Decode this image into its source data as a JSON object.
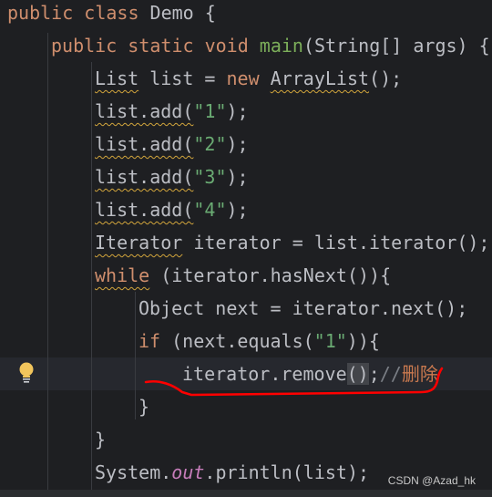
{
  "code_lines": [
    {
      "indent": 0,
      "tokens": [
        [
          "kw",
          "public class "
        ],
        [
          "",
          "Demo {"
        ]
      ]
    },
    {
      "indent": 4,
      "tokens": [
        [
          "kw",
          "public static void "
        ],
        [
          "fnd",
          "main"
        ],
        [
          "",
          "(String[] args) {"
        ]
      ]
    },
    {
      "indent": 8,
      "tokens": [
        [
          "warn",
          "List"
        ],
        [
          "",
          " list = "
        ],
        [
          "kw",
          "new "
        ],
        [
          "warn",
          "ArrayList"
        ],
        [
          "",
          "();"
        ]
      ]
    },
    {
      "indent": 8,
      "tokens": [
        [
          "warn",
          "list.add("
        ],
        [
          "str",
          "\"1\""
        ],
        [
          "",
          ");"
        ]
      ]
    },
    {
      "indent": 8,
      "tokens": [
        [
          "warn",
          "list.add("
        ],
        [
          "str",
          "\"2\""
        ],
        [
          "",
          ");"
        ]
      ]
    },
    {
      "indent": 8,
      "tokens": [
        [
          "warn",
          "list.add("
        ],
        [
          "str",
          "\"3\""
        ],
        [
          "",
          ");"
        ]
      ]
    },
    {
      "indent": 8,
      "tokens": [
        [
          "warn",
          "list.add("
        ],
        [
          "str",
          "\"4\""
        ],
        [
          "",
          ");"
        ]
      ]
    },
    {
      "indent": 8,
      "tokens": [
        [
          "warn",
          "Iterator"
        ],
        [
          "",
          " iterator = list.iterator();"
        ]
      ]
    },
    {
      "indent": 8,
      "tokens": [
        [
          "kw warn",
          "while"
        ],
        [
          "",
          " (iterator.hasNext()){"
        ]
      ]
    },
    {
      "indent": 12,
      "tokens": [
        [
          "",
          "Object next = iterator.next();"
        ]
      ]
    },
    {
      "indent": 12,
      "tokens": [
        [
          "kw",
          "if "
        ],
        [
          "",
          "(next.equals("
        ],
        [
          "str",
          "\"1\""
        ],
        [
          "",
          ")){"
        ]
      ]
    },
    {
      "indent": 16,
      "tokens": [
        [
          "",
          "iterator.remove"
        ],
        [
          "caretbox",
          "()"
        ],
        [
          "",
          ";"
        ],
        [
          "cm",
          "//"
        ],
        [
          "cmz",
          "删除"
        ]
      ]
    },
    {
      "indent": 12,
      "tokens": [
        [
          "",
          "}"
        ]
      ]
    },
    {
      "indent": 8,
      "tokens": [
        [
          "",
          "}"
        ]
      ]
    },
    {
      "indent": 8,
      "tokens": [
        [
          "",
          "System."
        ],
        [
          "st",
          "out"
        ],
        [
          "",
          ".println(list);"
        ]
      ]
    }
  ],
  "watermark": "CSDN @Azad_hk",
  "colors": {
    "background": "#1e1f22",
    "keyword": "#cf8e6d",
    "string": "#6aab73",
    "annotation": "#ff0000"
  }
}
